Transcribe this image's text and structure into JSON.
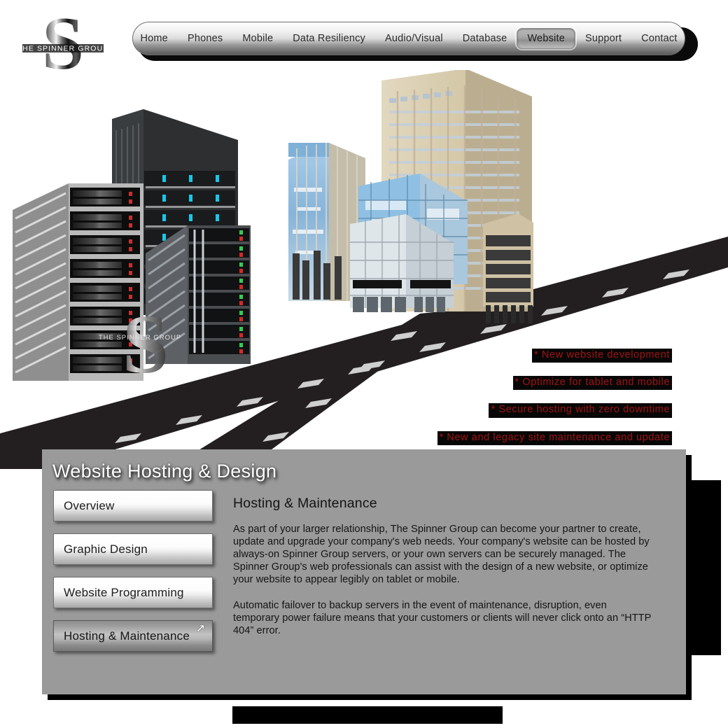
{
  "site": {
    "brand_name": "THE SPINNER GROUP",
    "logo_letter": "S"
  },
  "nav": {
    "items": [
      {
        "label": "Home",
        "active": false
      },
      {
        "label": "Phones",
        "active": false
      },
      {
        "label": "Mobile",
        "active": false
      },
      {
        "label": "Data Resiliency",
        "active": false
      },
      {
        "label": "Audio/Visual",
        "active": false
      },
      {
        "label": "Database",
        "active": false
      },
      {
        "label": "Website",
        "active": true
      },
      {
        "label": "Support",
        "active": false
      },
      {
        "label": "Contact",
        "active": false
      }
    ]
  },
  "hero": {
    "bullets": [
      "* New website development",
      "* Optimize for tablet and mobile",
      "* Secure hosting with zero downtime",
      "* New and legacy site maintenance and update"
    ],
    "bullet_text_color": "#8e1414",
    "bullet_bg_color": "#070707",
    "server_logo_caption": "THE SPINNER GROUP"
  },
  "panel": {
    "title": "Website Hosting & Design",
    "background_color": "#9a9a9a",
    "sidebar": [
      {
        "label": "Overview",
        "active": false
      },
      {
        "label": "Graphic Design",
        "active": false
      },
      {
        "label": "Website Programming",
        "active": false
      },
      {
        "label": "Hosting & Maintenance",
        "active": true
      }
    ],
    "cursor_glyph": "↗",
    "article": {
      "heading": "Hosting & Maintenance",
      "paragraphs": [
        "As part of your larger relationship, The Spinner Group can become your partner to create, update and upgrade your company's web needs.  Your company's website can be hosted by always-on Spinner Group servers, or your own servers can be securely managed.  The Spinner Group's web professionals can assist with the design of a new website, or optimize your website to appear legibly on tablet or mobile.",
        "Automatic failover to backup servers in the event of maintenance, disruption, even temporary power failure means that your customers or clients will never click onto an “HTTP 404” error."
      ]
    }
  }
}
